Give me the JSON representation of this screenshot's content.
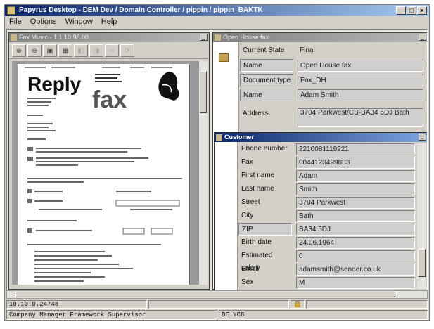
{
  "window": {
    "title": "Papyrus Desktop - DEM Dev / Domain Controller / pippin / pippin_BAKTK",
    "controls": [
      "_",
      "□",
      "×"
    ]
  },
  "menu": [
    "File",
    "Options",
    "Window",
    "Help"
  ],
  "doc_viewer": {
    "title": "Fax Music - 1.1.10.98.00",
    "toolbar": [
      {
        "name": "zoom-in",
        "glyph": "⊕"
      },
      {
        "name": "zoom-out",
        "glyph": "⊖"
      },
      {
        "name": "fit-page",
        "glyph": "▣"
      },
      {
        "name": "fit-width",
        "glyph": "▦"
      },
      {
        "name": "prev-page",
        "glyph": "◧"
      },
      {
        "name": "next-page",
        "glyph": "◨"
      },
      {
        "name": "forward",
        "glyph": "⇨"
      },
      {
        "name": "refresh",
        "glyph": "⟳"
      }
    ],
    "fax_page": {
      "reply_word": "Reply",
      "fax_word": "fax"
    }
  },
  "house": {
    "title": "Open House fax",
    "fields": [
      {
        "label": "Current State",
        "value": "Final",
        "boxed": false
      },
      {
        "label": "Name",
        "value": "Open House fax",
        "boxed": true
      },
      {
        "label": "Document type",
        "value": "Fax_DH",
        "boxed": true
      },
      {
        "label": "Name",
        "value": "Adam Smith",
        "boxed": true
      },
      {
        "label": "Address",
        "value": "3704 Parkwest/CB-BA34 5DJ Bath",
        "boxed": false
      }
    ]
  },
  "customer": {
    "title": "Customer",
    "fields": [
      {
        "label": "Phone number",
        "value": "2210081119221"
      },
      {
        "label": "Fax",
        "value": "0044123499883"
      },
      {
        "label": "First name",
        "value": "Adam"
      },
      {
        "label": "Last name",
        "value": "Smith"
      },
      {
        "label": "Street",
        "value": "3704 Parkwest"
      },
      {
        "label": "City",
        "value": "Bath"
      },
      {
        "label": "ZIP",
        "value": "BA34 5DJ"
      },
      {
        "label": "Birth date",
        "value": "24.06.1964"
      },
      {
        "label": "Estimated salary",
        "value": "0"
      },
      {
        "label": "Email",
        "value": "adamsmith@sender.co.uk"
      },
      {
        "label": "Sex",
        "value": "M"
      }
    ]
  },
  "status": {
    "left": "10.10.0.24748",
    "right": "",
    "bottom_left": "Company Manager Framework Supervisor",
    "bottom_right": "DE YCB"
  }
}
